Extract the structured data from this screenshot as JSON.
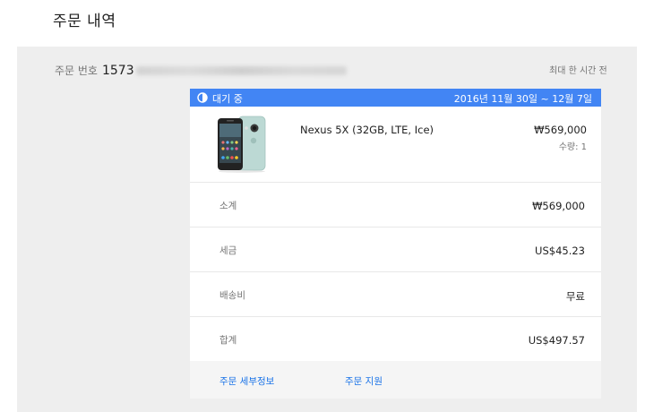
{
  "page": {
    "title": "주문 내역"
  },
  "order": {
    "number_label": "주문 번호",
    "number_visible": "1573",
    "max_time_text": "최대 한 시간 전"
  },
  "status": {
    "label": "대기 중",
    "date_range": "2016년 11월 30일 ~ 12월 7일",
    "color": "#4285f4",
    "icon": "half-circle-icon"
  },
  "item": {
    "name": "Nexus 5X (32GB, LTE, Ice)",
    "price": "₩569,000",
    "quantity": "수량: 1",
    "image": "phone-image"
  },
  "summary": {
    "subtotal": {
      "label": "소계",
      "value": "₩569,000"
    },
    "tax": {
      "label": "세금",
      "value": "US$45.23"
    },
    "shipping": {
      "label": "배송비",
      "value": "무료"
    },
    "total": {
      "label": "합계",
      "value": "US$497.57"
    }
  },
  "links": {
    "details": "주문 세부정보",
    "support": "주문 지원",
    "color": "#1a73e8"
  }
}
